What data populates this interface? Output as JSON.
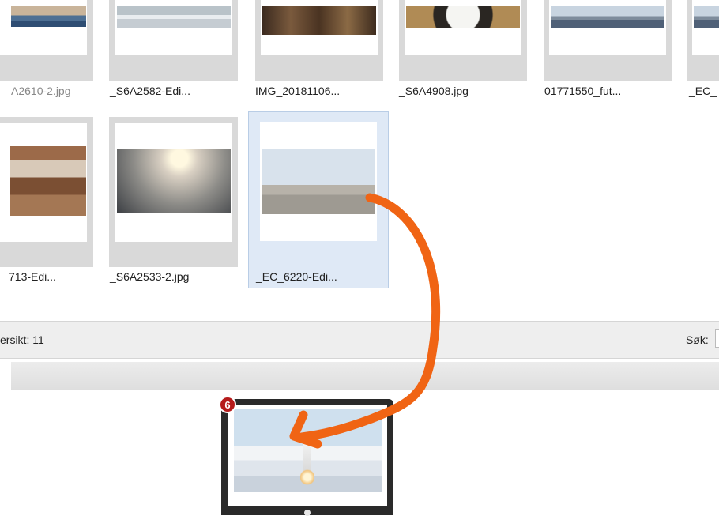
{
  "gallery": {
    "row1": [
      {
        "name": "A2610-2.jpg",
        "image": "harbor-photo",
        "state": "dim"
      },
      {
        "name": "_S6A2582-Edi...",
        "image": "snow-photo",
        "state": "normal"
      },
      {
        "name": "IMG_20181106...",
        "image": "interior-photo",
        "state": "normal"
      },
      {
        "name": "_S6A4908.jpg",
        "image": "cat-photo",
        "state": "normal"
      },
      {
        "name": "01771550_fut...",
        "image": "lake-photo",
        "state": "normal"
      },
      {
        "name": "_EC_",
        "image": "partial-photo",
        "state": "normal"
      }
    ],
    "row2": [
      {
        "name": "713-Edi...",
        "image": "cafe-photo",
        "state": "normal"
      },
      {
        "name": "_S6A2533-2.jpg",
        "image": "sunset-photo",
        "state": "normal"
      },
      {
        "name": "_EC_6220-Edi...",
        "image": "statue-photo",
        "state": "selected"
      }
    ]
  },
  "status": {
    "count_text": "ersikt: 11",
    "search_label": "Søk:",
    "search_value": ""
  },
  "display": {
    "badge": "6",
    "image": "rocket-launch-photo"
  },
  "annotation": {
    "arrow_color": "#f06414",
    "description_icon": "drag-arrow-icon"
  },
  "colors": {
    "selection_fill": "#dfe9f6",
    "selection_border": "#b9cde6",
    "badge_color": "#b51b1b"
  }
}
